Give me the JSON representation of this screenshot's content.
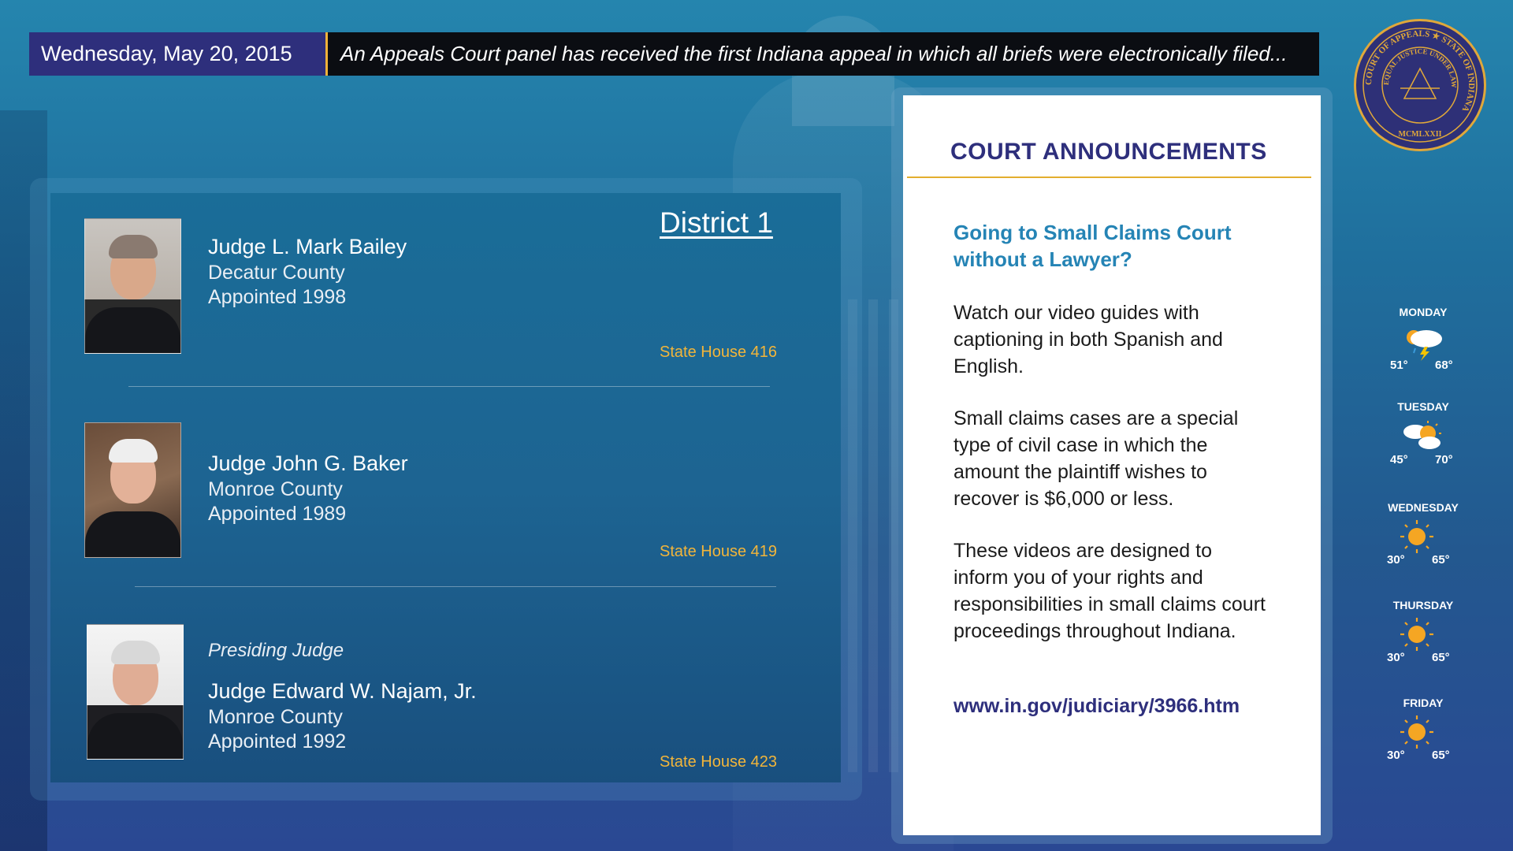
{
  "header": {
    "date": "Wednesday, May 20, 2015",
    "ticker": "An Appeals Court panel has received the first Indiana appeal in which all briefs were electronically filed..."
  },
  "seal": {
    "text_top": "COURT OF APPEALS ★ STATE OF INDIANA",
    "text_inner": "EQUAL JUSTICE UNDER LAW",
    "year": "MCMLXXII"
  },
  "district": {
    "title": "District 1",
    "judges": [
      {
        "name": "Judge L. Mark Bailey",
        "county": "Decatur County",
        "appointed": "Appointed 1998",
        "room": "State House  416"
      },
      {
        "name": "Judge John G. Baker",
        "county": "Monroe County",
        "appointed": "Appointed 1989",
        "room": "State House  419"
      },
      {
        "role": "Presiding Judge",
        "name": "Judge Edward W. Najam, Jr.",
        "county": "Monroe  County",
        "appointed": "Appointed 1992",
        "room": "State House  423"
      }
    ]
  },
  "announcements": {
    "title": "COURT ANNOUNCEMENTS",
    "heading": "Going to Small Claims Court without a Lawyer?",
    "paragraphs": [
      "Watch our video guides with captioning in both Spanish and English.",
      "Small claims cases are a special type of civil case in which the amount the plaintiff wishes to recover is $6,000 or less.",
      "These videos are designed to inform you of your rights and responsibilities in small claims court proceedings throughout Indiana."
    ],
    "link": "www.in.gov/judiciary/3966.htm"
  },
  "weather": [
    {
      "day": "MONDAY",
      "icon": "thunderstorm-icon",
      "low": "51°",
      "high": "68°"
    },
    {
      "day": "TUESDAY",
      "icon": "partly-cloudy-icon",
      "low": "45°",
      "high": "70°"
    },
    {
      "day": "WEDNESDAY",
      "icon": "sunny-icon",
      "low": "30°",
      "high": "65°"
    },
    {
      "day": "THURSDAY",
      "icon": "sunny-icon",
      "low": "30°",
      "high": "65°"
    },
    {
      "day": "FRIDAY",
      "icon": "sunny-icon",
      "low": "30°",
      "high": "65°"
    }
  ],
  "colors": {
    "navy": "#2e2f7c",
    "gold": "#f2b53a",
    "link_blue": "#2584b5"
  }
}
